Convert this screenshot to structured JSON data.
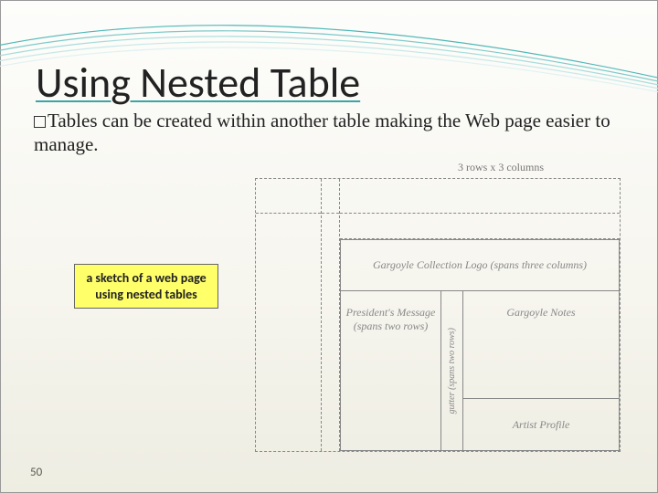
{
  "title": "Using Nested Table",
  "bullet_text": "Tables can be created within another table making the Web page easier to manage.",
  "callout_text": "a sketch of a web page using nested tables",
  "page_number": "50",
  "sketch": {
    "caption": "3 rows x 3 columns",
    "header": "Gargoyle Collection Logo (spans three columns)",
    "president": "President's Message (spans two rows)",
    "gutter": "gutter (spans two rows)",
    "notes": "Gargoyle Notes",
    "artist": "Artist Profile"
  }
}
